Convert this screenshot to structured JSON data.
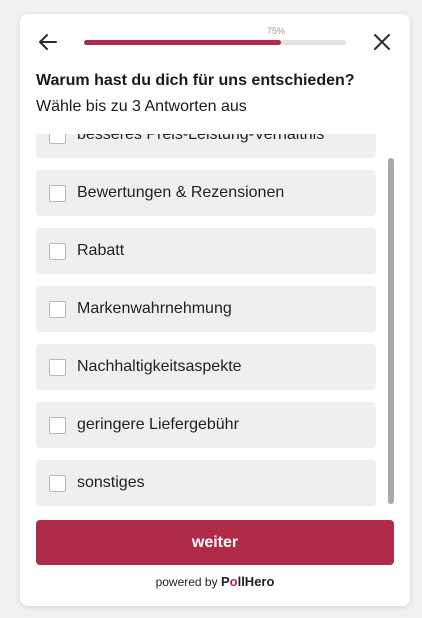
{
  "header": {
    "progress_percent": 75,
    "progress_label": "75%",
    "back_icon": "arrow-left-icon",
    "close_icon": "close-icon"
  },
  "question": {
    "title": "Warum hast du dich für uns entschieden?",
    "hint": "Wähle bis zu 3 Antworten aus"
  },
  "options": [
    {
      "label": "besseres Preis-Leistung-Verhältnis",
      "checked": false
    },
    {
      "label": "Bewertungen & Rezensionen",
      "checked": false
    },
    {
      "label": "Rabatt",
      "checked": false
    },
    {
      "label": "Markenwahrnehmung",
      "checked": false
    },
    {
      "label": "Nachhaltigkeitsaspekte",
      "checked": false
    },
    {
      "label": "geringere Liefergebühr",
      "checked": false
    },
    {
      "label": "sonstiges",
      "checked": false
    }
  ],
  "submit": {
    "label": "weiter"
  },
  "footer": {
    "powered_by": "powered by",
    "brand_first": "P",
    "brand_accent": "o",
    "brand_rest": "llHero"
  },
  "colors": {
    "accent": "#b02a49",
    "option_bg": "#efefef",
    "progress_track": "#e2e2e2"
  }
}
